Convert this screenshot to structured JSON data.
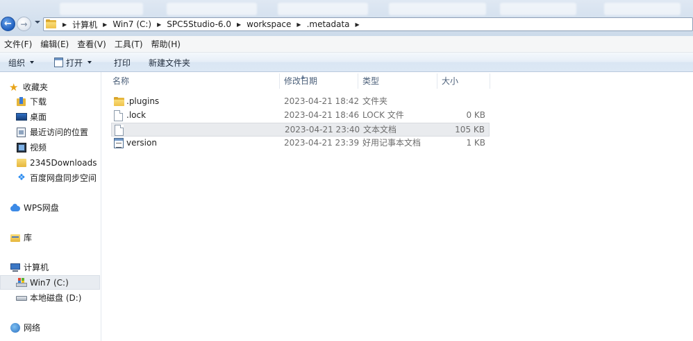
{
  "window": {
    "background_tabs_note": "",
    "colors": {
      "accent": "#1f5fbf",
      "folder": "#e6b63c",
      "selection": "#e9ebee"
    }
  },
  "nav": {
    "back_icon": "back-arrow-icon",
    "forward_icon": "forward-arrow-icon",
    "breadcrumbs": [
      "计算机",
      "Win7 (C:)",
      "SPC5Studio-6.0",
      "workspace",
      ".metadata"
    ]
  },
  "menu": {
    "file": "文件(F)",
    "edit": "编辑(E)",
    "view": "查看(V)",
    "tools": "工具(T)",
    "help": "帮助(H)"
  },
  "commands": {
    "organize": "组织",
    "open": "打开",
    "print": "打印",
    "new_folder": "新建文件夹"
  },
  "sidebar": {
    "favorites": "收藏夹",
    "downloads": "下载",
    "desktop": "桌面",
    "recent": "最近访问的位置",
    "videos": "视频",
    "downloads2345": "2345Downloads",
    "baidu": "百度网盘同步空间",
    "wps": "WPS网盘",
    "libraries": "库",
    "computer": "计算机",
    "drive_c": "Win7 (C:)",
    "drive_d": "本地磁盘 (D:)",
    "network": "网络"
  },
  "columns": {
    "name": "名称",
    "date": "修改日期",
    "type": "类型",
    "size": "大小"
  },
  "files": [
    {
      "name": ".plugins",
      "date": "2023-04-21 18:42",
      "type": "文件夹",
      "size": "",
      "icon": "folder-icon"
    },
    {
      "name": ".lock",
      "date": "2023-04-21 18:46",
      "type": "LOCK 文件",
      "size": "0 KB",
      "icon": "file-icon"
    },
    {
      "name": "",
      "date": "2023-04-21 23:40",
      "type": "文本文档",
      "size": "105 KB",
      "icon": "file-icon"
    },
    {
      "name": "version",
      "date": "2023-04-21 23:39",
      "type": "好用记事本文档",
      "size": "1 KB",
      "icon": "notepad-icon"
    }
  ]
}
